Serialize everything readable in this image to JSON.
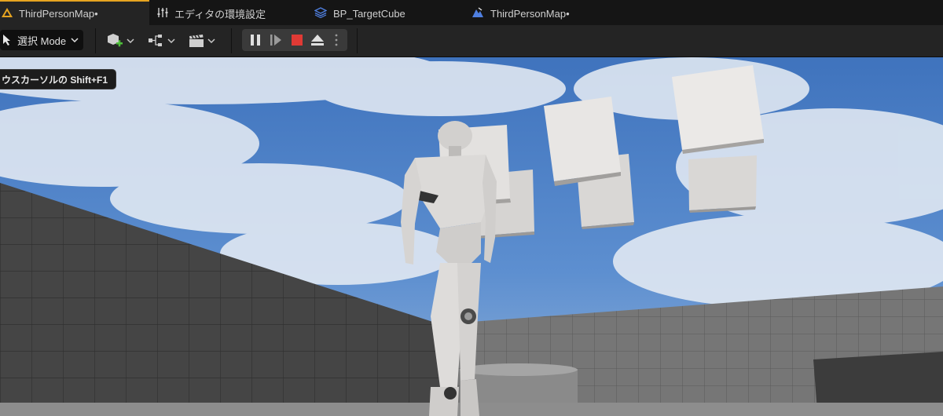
{
  "tabs": [
    {
      "label": "ThirdPersonMap•",
      "icon": "unreal-level-icon",
      "active": true
    },
    {
      "label": "エディタの環境設定",
      "icon": "sliders-icon",
      "active": false
    },
    {
      "label": "BP_TargetCube",
      "icon": "blueprint-icon",
      "active": false
    },
    {
      "label": "ThirdPersonMap•",
      "icon": "level-map-icon",
      "active": false
    }
  ],
  "toolbar": {
    "mode_label": "選択 Mode",
    "icons": [
      "select-mode-icon",
      "add-actor-icon",
      "blueprint-graph-icon",
      "cinematics-icon"
    ]
  },
  "play_controls": {
    "icons": [
      "pause-icon",
      "step-frame-icon",
      "stop-icon",
      "eject-icon",
      "more-options-icon"
    ],
    "stop_color": "#e03a35"
  },
  "tooltip": {
    "text": "ウスカーソルの Shift+F1"
  },
  "colors": {
    "accent": "#e6a420",
    "tab_bg": "#151515",
    "toolbar_bg": "#242424",
    "sky_top": "#4a7ec8",
    "floor": "#7a7a7a"
  }
}
